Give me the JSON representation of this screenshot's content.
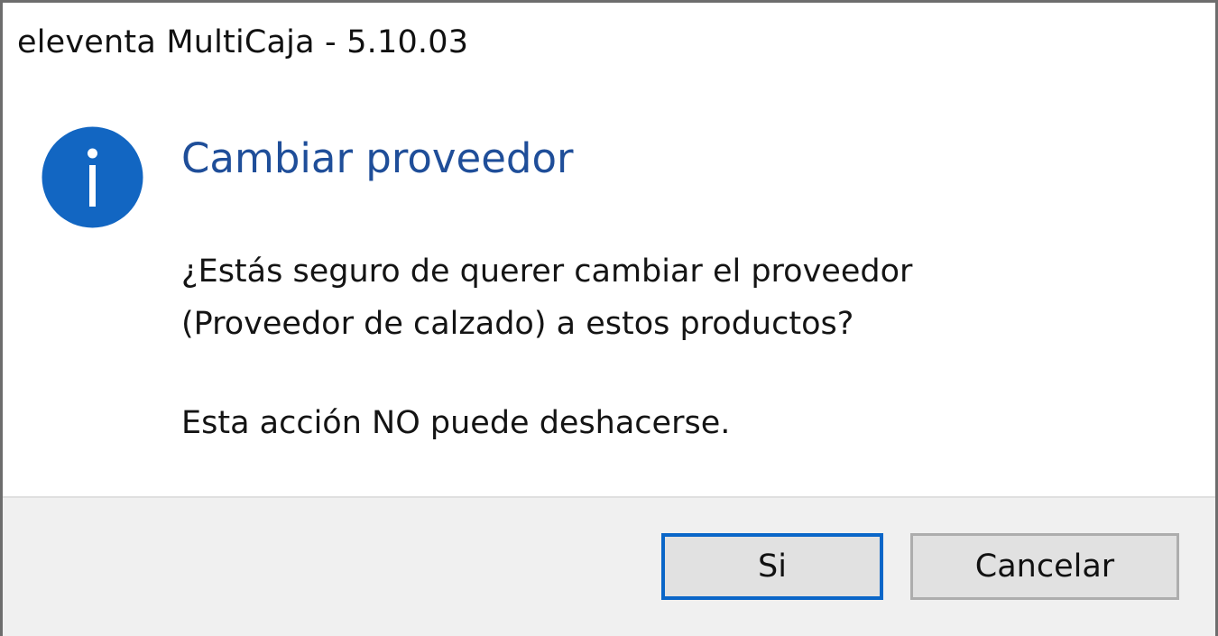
{
  "window": {
    "title": "eleventa MultiCaja - 5.10.03"
  },
  "dialog": {
    "icon": "info-icon",
    "heading": "Cambiar proveedor",
    "message_line1": "¿Estás seguro de querer cambiar el proveedor",
    "message_line2": "(Proveedor de calzado) a estos productos?",
    "warning": "Esta acción NO puede deshacerse."
  },
  "buttons": {
    "yes_label": "Si",
    "cancel_label": "Cancelar"
  },
  "colors": {
    "accent": "#0a66c8",
    "heading": "#1f4e99",
    "icon_fill": "#1266c2"
  }
}
